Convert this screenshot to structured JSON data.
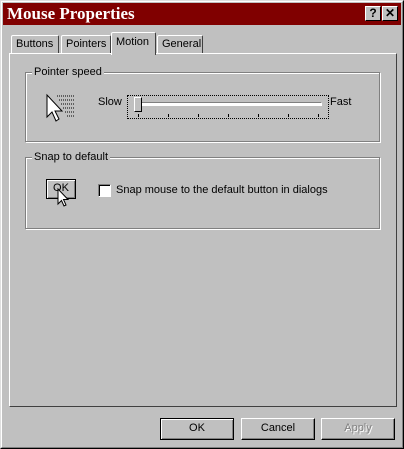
{
  "window": {
    "title": "Mouse Properties",
    "help_button": "?",
    "close_button": "✕"
  },
  "tabs": [
    {
      "label": "Buttons",
      "active": false
    },
    {
      "label": "Pointers",
      "active": false
    },
    {
      "label": "Motion",
      "active": true
    },
    {
      "label": "General",
      "active": false
    }
  ],
  "pointer_speed": {
    "legend": "Pointer speed",
    "slow_label": "Slow",
    "fast_label": "Fast",
    "level": 0,
    "tick_count": 7,
    "icon": "pointer-trail-icon"
  },
  "snap_to_default": {
    "legend": "Snap to default",
    "sample_button": "OK",
    "checkbox_label": "Snap mouse to the default button in dialogs",
    "checked": false,
    "icon": "arrow-cursor-icon"
  },
  "footer": {
    "ok": "OK",
    "cancel": "Cancel",
    "apply": "Apply"
  },
  "colors": {
    "titlebar": "#800000",
    "face": "#c0c0c0"
  }
}
